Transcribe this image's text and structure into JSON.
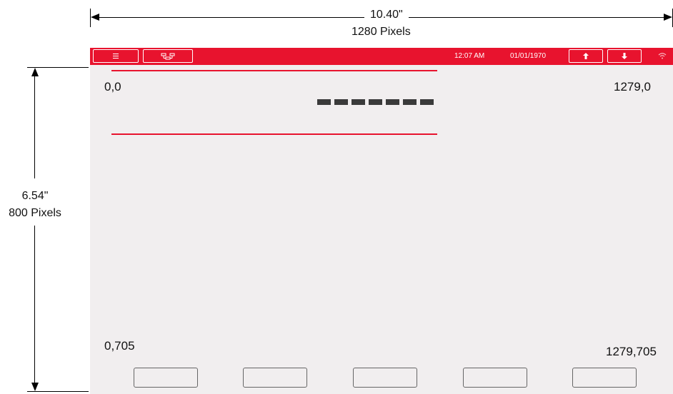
{
  "dimensions": {
    "width_inches": "10.40\"",
    "width_pixels": "1280 Pixels",
    "height_inches": "6.54\"",
    "height_pixels": "800 Pixels"
  },
  "topbar": {
    "menu_icon": "menu-icon",
    "network_icon": "network-icon",
    "time": "12:07 AM",
    "date": "01/01/1970",
    "up_icon": "arrow-up-icon",
    "down_icon": "arrow-down-icon",
    "wifi_icon": "wifi-icon"
  },
  "coords": {
    "top_left": "0,0",
    "top_right": "1279,0",
    "bottom_left": "0,705",
    "bottom_right": "1279,705"
  },
  "colors": {
    "accent": "#e8132e",
    "screen_bg": "#f1eeef"
  }
}
